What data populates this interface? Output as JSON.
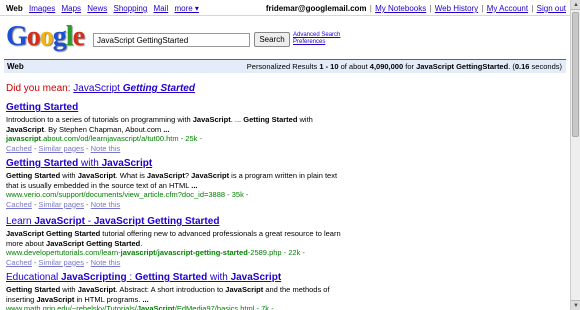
{
  "topnav": {
    "current": "Web",
    "links": [
      "Images",
      "Maps",
      "News",
      "Shopping",
      "Mail",
      "more ▾"
    ]
  },
  "account": {
    "email": "fridemar@googlemail.com",
    "links": [
      "My Notebooks",
      "Web History",
      "My Account",
      "Sign out"
    ]
  },
  "logo": {
    "letters": [
      "G",
      "o",
      "o",
      "g",
      "l",
      "e"
    ],
    "colors": [
      "#1a4fd6",
      "#d62c1a",
      "#f2b50f",
      "#1a4fd6",
      "#2a9d2a",
      "#d62c1a"
    ]
  },
  "search": {
    "query": "JavaScript GettingStarted",
    "button_label": "Search",
    "advanced_label": "Advanced Search",
    "preferences_label": "Preferences"
  },
  "statsbar": {
    "label": "Web",
    "prefix": "Personalized Results ",
    "range": "1 - 10",
    "of_about": " of about ",
    "count": "4,090,000",
    "for": " for ",
    "query": "JavaScript GettingStarted",
    "time_prefix": ". (",
    "time": "0.16",
    "time_suffix": " seconds)"
  },
  "did_you_mean": {
    "prompt": "Did you mean:",
    "plain": "JavaScript",
    "emph": "Getting Started"
  },
  "results": [
    {
      "title_parts": [
        [
          "Getting Started",
          true
        ]
      ],
      "snippet_parts": [
        [
          "Introduction to a series of tutorials on programming with ",
          false
        ],
        [
          "JavaScript",
          true
        ],
        [
          ". ... ",
          false
        ],
        [
          "Getting Started",
          true
        ],
        [
          " with ",
          false
        ],
        [
          "JavaScript",
          true
        ],
        [
          ". By Stephen Chapman, About.com ",
          false
        ],
        [
          "...",
          true
        ]
      ],
      "url_parts": [
        [
          "javascript",
          true
        ],
        [
          ".about.com/od/learnjavascript/a/tut00.htm - 25k - ",
          false
        ]
      ],
      "cached": "Cached",
      "similar": "Similar pages",
      "note": "Note this"
    },
    {
      "title_parts": [
        [
          "Getting Started",
          true
        ],
        [
          " with ",
          false
        ],
        [
          "JavaScript",
          true
        ]
      ],
      "snippet_parts": [
        [
          "Getting Started",
          true
        ],
        [
          " with ",
          false
        ],
        [
          "JavaScript",
          true
        ],
        [
          ". What is ",
          false
        ],
        [
          "JavaScript",
          true
        ],
        [
          "? ",
          false
        ],
        [
          "JavaScript",
          true
        ],
        [
          " is a program written in plain text that is usually embedded in the source text of an HTML ",
          false
        ],
        [
          "...",
          true
        ]
      ],
      "url_parts": [
        [
          "www.verio.com/support/documents/view_article.cfm?doc_id=3888 - 35k - ",
          false
        ]
      ],
      "cached": "Cached",
      "similar": "Similar pages",
      "note": "Note this"
    },
    {
      "title_parts": [
        [
          "Learn ",
          false
        ],
        [
          "JavaScript",
          true
        ],
        [
          " - ",
          false
        ],
        [
          "JavaScript Getting Started",
          true
        ]
      ],
      "snippet_parts": [
        [
          "JavaScript Getting Started",
          true
        ],
        [
          " tutorial offering new to advanced professionals a great resource to learn more about ",
          false
        ],
        [
          "JavaScript",
          true
        ],
        [
          " ",
          false
        ],
        [
          "Getting Started",
          true
        ],
        [
          ".",
          false
        ]
      ],
      "url_parts": [
        [
          "www.developertutorials.com/learn-",
          false
        ],
        [
          "javascript",
          true
        ],
        [
          "/",
          false
        ],
        [
          "javascript-getting-started",
          true
        ],
        [
          "-2589.php - 22k - ",
          false
        ]
      ],
      "cached": "Cached",
      "similar": "Similar pages",
      "note": "Note this"
    },
    {
      "title_parts": [
        [
          "Educational ",
          false
        ],
        [
          "JavaScripting",
          true
        ],
        [
          " : ",
          false
        ],
        [
          "Getting Started",
          true
        ],
        [
          " with ",
          false
        ],
        [
          "JavaScript",
          true
        ]
      ],
      "snippet_parts": [
        [
          "Getting Started",
          true
        ],
        [
          " with ",
          false
        ],
        [
          "JavaScript",
          true
        ],
        [
          ". Abstract: A short introduction to ",
          false
        ],
        [
          "JavaScript",
          true
        ],
        [
          " and the methods of inserting ",
          false
        ],
        [
          "JavaScript",
          true
        ],
        [
          " in HTML programs. ",
          false
        ],
        [
          "...",
          true
        ]
      ],
      "url_parts": [
        [
          "www.math.grin.edu/~rebelsky/Tutorials/",
          false
        ],
        [
          "JavaScript",
          true
        ],
        [
          "/EdMedia97/basics.html - 7k - ",
          false
        ]
      ],
      "cached": "",
      "similar": "",
      "note": ""
    }
  ],
  "sep": " - "
}
